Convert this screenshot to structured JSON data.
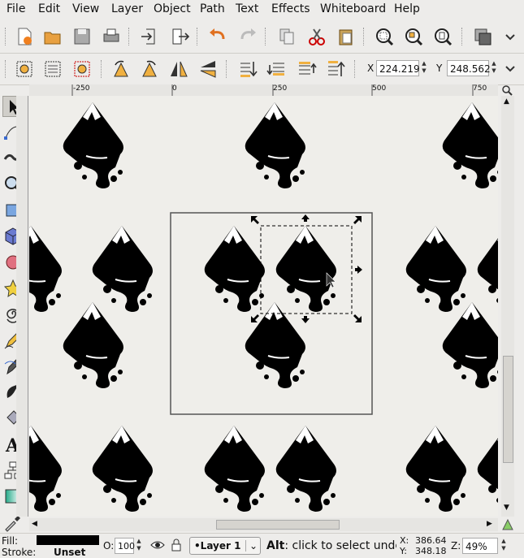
{
  "menubar": {
    "items": [
      "File",
      "Edit",
      "View",
      "Layer",
      "Object",
      "Path",
      "Text",
      "Effects",
      "Whiteboard",
      "Help"
    ]
  },
  "controls": {
    "x_label": "X",
    "x_value": "224.219",
    "y_label": "Y",
    "y_value": "248.562"
  },
  "ruler": {
    "labels": [
      "-250",
      "0",
      "250",
      "500",
      "750"
    ]
  },
  "statusbar": {
    "fill_label": "Fill:",
    "stroke_label": "Stroke:",
    "stroke_value": "Unset",
    "opacity_label": "O:",
    "opacity_value": "100",
    "layer_name": "•Layer 1",
    "message_bold": "Alt",
    "message": ": click to select unde...",
    "cursor_x_label": "X:",
    "cursor_x": "386.64",
    "cursor_y_label": "Y:",
    "cursor_y": "348.18",
    "zoom_label": "Z:",
    "zoom_value": "49%"
  },
  "colors": {
    "fill_swatch": "#000000",
    "canvas": "#efeeea",
    "page_border": "#555555"
  }
}
